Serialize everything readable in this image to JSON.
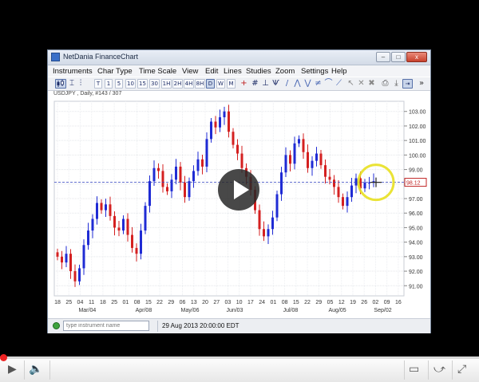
{
  "window": {
    "title": "NetDania FinanceChart",
    "minimize_glyph": "–",
    "maximize_glyph": "□",
    "close_glyph": "x"
  },
  "menu": [
    "Instruments",
    "Char Type",
    "Time Scale",
    "View",
    "Edit",
    "Lines",
    "Studies",
    "Zoom",
    "Settings",
    "Help"
  ],
  "toolbar": {
    "timeframes": [
      "T",
      "1",
      "5",
      "10",
      "15",
      "30",
      "1H",
      "2H",
      "4H",
      "8H",
      "D",
      "W",
      "M"
    ],
    "selected_timeframe": "D"
  },
  "chart": {
    "label": "USDJPY , Daily, #143 / 307",
    "current_price": "98.12"
  },
  "chart_data": {
    "type": "candlestick",
    "y_ticks": [
      "103.00",
      "102.00",
      "101.00",
      "100.00",
      "99.00",
      "98.00",
      "97.00",
      "96.00",
      "95.00",
      "94.00",
      "93.00",
      "92.00",
      "91.00"
    ],
    "ylim": [
      90.3,
      103.7
    ],
    "x_tick_labels": [
      "18",
      "25",
      "04",
      "11",
      "18",
      "25",
      "01",
      "08",
      "15",
      "22",
      "29",
      "06",
      "13",
      "20",
      "27",
      "03",
      "10",
      "17",
      "24",
      "01",
      "08",
      "15",
      "22",
      "29",
      "05",
      "12",
      "19",
      "26",
      "02",
      "09",
      "16"
    ],
    "month_labels": [
      {
        "label": "Mar/04",
        "tick_index": 2
      },
      {
        "label": "Apr/08",
        "tick_index": 7
      },
      {
        "label": "May/06",
        "tick_index": 11
      },
      {
        "label": "Jun/03",
        "tick_index": 15
      },
      {
        "label": "Jul/08",
        "tick_index": 20
      },
      {
        "label": "Aug/05",
        "tick_index": 24
      },
      {
        "label": "Sep/02",
        "tick_index": 28
      }
    ],
    "last_price": 98.12,
    "closes": [
      93.0,
      92.6,
      93.2,
      92.0,
      91.3,
      92.2,
      93.8,
      94.8,
      95.6,
      96.7,
      96.2,
      96.6,
      95.8,
      95.0,
      94.8,
      95.6,
      94.5,
      93.6,
      93.2,
      94.8,
      96.5,
      98.2,
      99.1,
      98.9,
      97.8,
      97.5,
      98.3,
      99.2,
      98.1,
      97.1,
      98.2,
      98.9,
      99.7,
      99.2,
      101.1,
      102.3,
      101.9,
      102.6,
      103.0,
      101.6,
      100.7,
      100.1,
      99.1,
      98.5,
      97.6,
      96.2,
      94.9,
      94.4,
      94.9,
      95.7,
      97.3,
      98.8,
      100.0,
      99.4,
      100.8,
      101.1,
      100.2,
      99.1,
      99.6,
      100.1,
      99.3,
      98.5,
      98.3,
      97.8,
      97.1,
      96.5,
      97.1,
      97.9,
      98.4,
      97.7,
      98.1,
      98.1,
      98.2
    ]
  },
  "status": {
    "instrument_placeholder": "type instrument name",
    "timestamp": "29 Aug 2013 20:00:00 EDT"
  },
  "player": {
    "progress": 0.0,
    "play_icon": "play-icon",
    "volume_icon": "volume-icon",
    "captions_icon": "captions-icon",
    "share_icon": "share-icon",
    "fullscreen_icon": "fullscreen-icon"
  }
}
